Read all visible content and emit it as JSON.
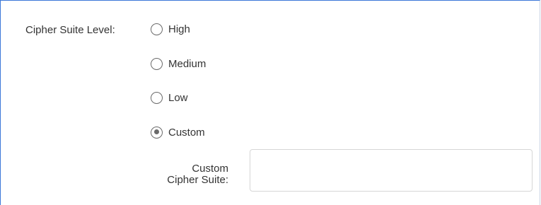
{
  "cipher_suite": {
    "label": "Cipher Suite Level:",
    "options": [
      {
        "label": "High",
        "checked": false
      },
      {
        "label": "Medium",
        "checked": false
      },
      {
        "label": "Low",
        "checked": false
      },
      {
        "label": "Custom",
        "checked": true
      }
    ],
    "selected": "Custom"
  },
  "custom_cipher_suite": {
    "label_line1": "Custom",
    "label_line2": "Cipher Suite:",
    "value": "",
    "placeholder": ""
  },
  "colors": {
    "panel_border": "#3b78d8",
    "text": "#333333",
    "radio_border": "#6a6a6a",
    "input_border": "#d6d6d6"
  }
}
